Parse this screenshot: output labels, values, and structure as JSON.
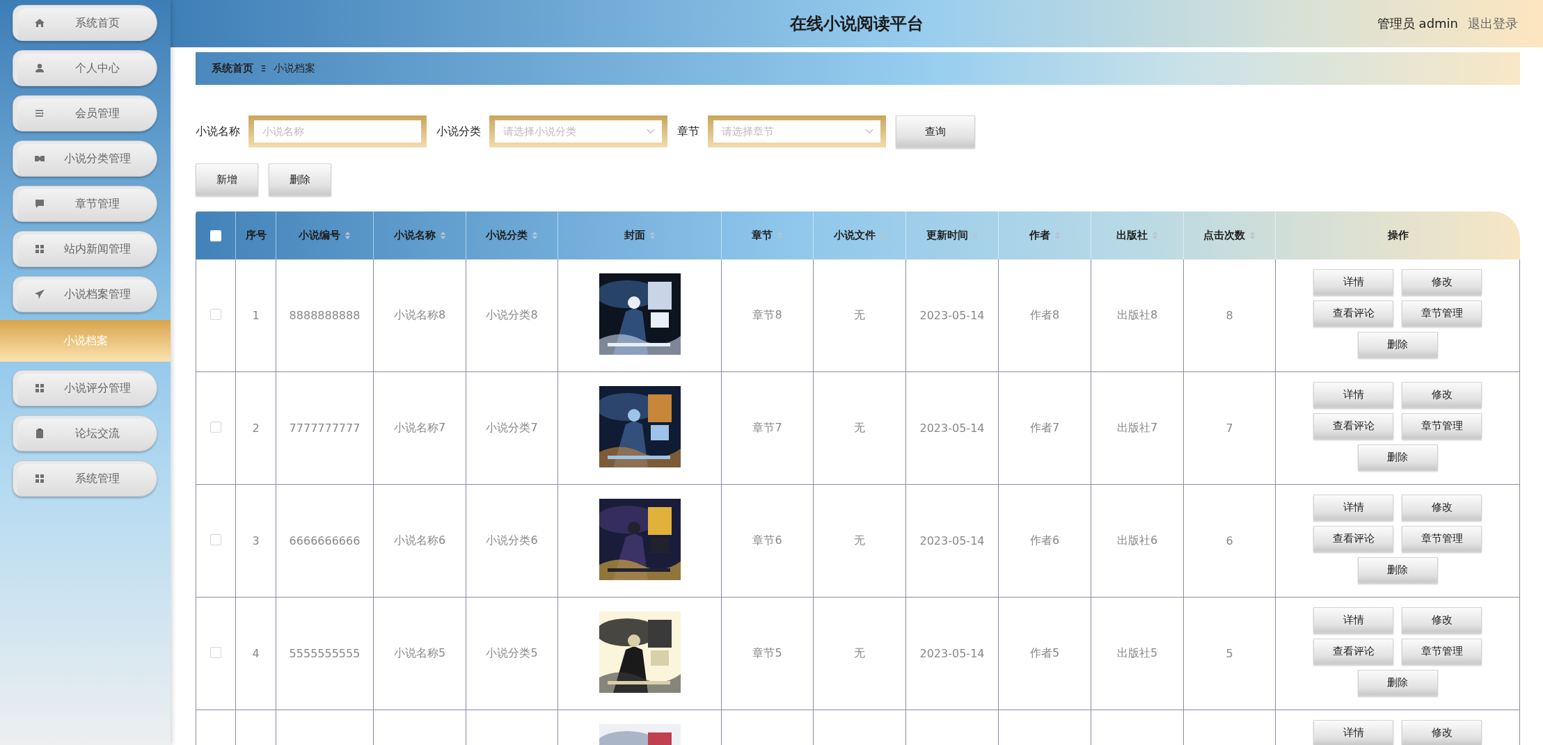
{
  "header": {
    "title": "在线小说阅读平台",
    "user": "管理员 admin",
    "logout": "退出登录"
  },
  "sidebar": {
    "items": [
      {
        "label": "系统首页",
        "selected": false
      },
      {
        "label": "个人中心",
        "selected": false
      },
      {
        "label": "会员管理",
        "selected": false
      },
      {
        "label": "小说分类管理",
        "selected": false
      },
      {
        "label": "章节管理",
        "selected": false
      },
      {
        "label": "站内新闻管理",
        "selected": false
      },
      {
        "label": "小说档案管理",
        "selected": false,
        "children": [
          {
            "label": "小说档案",
            "selected": true
          }
        ]
      },
      {
        "label": "小说评分管理",
        "selected": false
      },
      {
        "label": "论坛交流",
        "selected": false
      },
      {
        "label": "系统管理",
        "selected": false
      }
    ]
  },
  "breadcrumb": [
    "系统首页",
    "小说档案"
  ],
  "search": {
    "fields": [
      {
        "kind": "input",
        "label": "小说名称",
        "placeholder": "小说名称"
      },
      {
        "kind": "select",
        "label": "小说分类",
        "placeholder": "请选择小说分类"
      },
      {
        "kind": "select",
        "label": "章节",
        "placeholder": "请选择章节"
      }
    ],
    "button": "查询"
  },
  "actions": [
    "新增",
    "删除"
  ],
  "table": {
    "select_all": {
      "checked": false
    },
    "columns": [
      {
        "label": "序号",
        "sortable": false
      },
      {
        "label": "小说编号",
        "sortable": true
      },
      {
        "label": "小说名称",
        "sortable": true
      },
      {
        "label": "小说分类",
        "sortable": true
      },
      {
        "label": "封面",
        "sortable": true
      },
      {
        "label": "章节",
        "sortable": true
      },
      {
        "label": "小说文件",
        "sortable": true
      },
      {
        "label": "更新时间",
        "sortable": true
      },
      {
        "label": "作者",
        "sortable": true
      },
      {
        "label": "出版社",
        "sortable": true
      },
      {
        "label": "点击次数",
        "sortable": true
      },
      {
        "label": "操作",
        "sortable": false
      }
    ],
    "rows": [
      {
        "checked": false,
        "index": "1",
        "id": "8888888888",
        "name": "小说名称8",
        "category": "小说分类8",
        "cover": {
          "kind": "picture"
        },
        "chapter": "章节8",
        "file": "无",
        "updated": "2023-05-14",
        "author": "作者8",
        "publisher": "出版社8",
        "clicks": "8",
        "actions": [
          "详情",
          "修改",
          "查看评论",
          "章节管理",
          "删除"
        ]
      },
      {
        "checked": false,
        "index": "2",
        "id": "7777777777",
        "name": "小说名称7",
        "category": "小说分类7",
        "cover": {
          "kind": "picture"
        },
        "chapter": "章节7",
        "file": "无",
        "updated": "2023-05-14",
        "author": "作者7",
        "publisher": "出版社7",
        "clicks": "7",
        "actions": [
          "详情",
          "修改",
          "查看评论",
          "章节管理",
          "删除"
        ]
      },
      {
        "checked": false,
        "index": "3",
        "id": "6666666666",
        "name": "小说名称6",
        "category": "小说分类6",
        "cover": {
          "kind": "picture"
        },
        "chapter": "章节6",
        "file": "无",
        "updated": "2023-05-14",
        "author": "作者6",
        "publisher": "出版社6",
        "clicks": "6",
        "actions": [
          "详情",
          "修改",
          "查看评论",
          "章节管理",
          "删除"
        ]
      },
      {
        "checked": false,
        "index": "4",
        "id": "5555555555",
        "name": "小说名称5",
        "category": "小说分类5",
        "cover": {
          "kind": "picture"
        },
        "chapter": "章节5",
        "file": "无",
        "updated": "2023-05-14",
        "author": "作者5",
        "publisher": "出版社5",
        "clicks": "5",
        "actions": [
          "详情",
          "修改",
          "查看评论",
          "章节管理",
          "删除"
        ]
      },
      {
        "cover": {
          "kind": "picture"
        },
        "actions": [
          "详情",
          "修改"
        ]
      }
    ]
  }
}
